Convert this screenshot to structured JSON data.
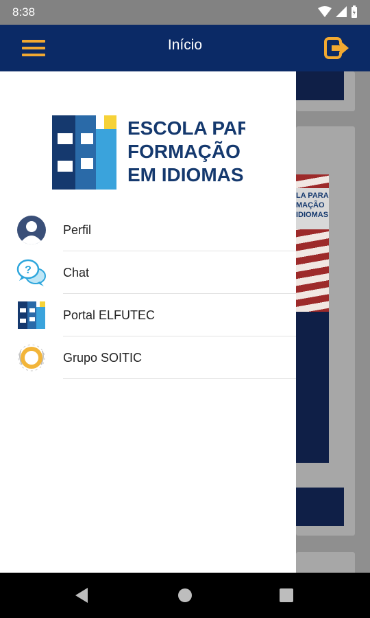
{
  "status": {
    "time": "8:38"
  },
  "appbar": {
    "title": "Início"
  },
  "logo": {
    "line1": "ESCOLA PARA",
    "line2": "FORMAÇÃO",
    "line3": "EM IDIOMAS"
  },
  "menu": [
    {
      "label": "Perfil",
      "icon": "profile-icon"
    },
    {
      "label": "Chat",
      "icon": "chat-icon"
    },
    {
      "label": "Portal ELFUTEC",
      "icon": "efi-logo-icon"
    },
    {
      "label": "Grupo SOITIC",
      "icon": "soitic-icon"
    }
  ],
  "background_banner": {
    "line1": "LA PARA",
    "line2": "MAÇÃO",
    "line3": "IDIOMAS"
  },
  "colors": {
    "appbar": "#0b2a66",
    "accent": "#f2a931",
    "logo_navy": "#15396e",
    "logo_blue": "#3aa3dc",
    "logo_yellow": "#f6d238"
  }
}
